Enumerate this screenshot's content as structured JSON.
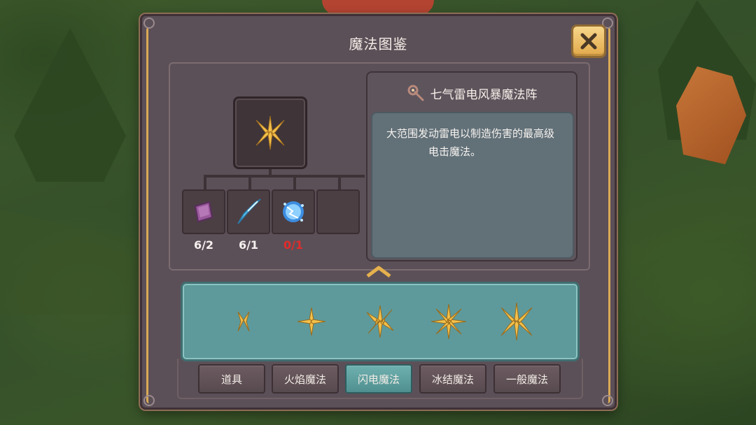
{
  "window": {
    "title": "魔法图鉴",
    "close_label": "✕"
  },
  "recipe": {
    "ingredients": [
      {
        "icon": "purple-crystal-icon",
        "count": "6/2",
        "sufficient": true
      },
      {
        "icon": "blue-shard-icon",
        "count": "6/1",
        "sufficient": true
      },
      {
        "icon": "lightning-orb-icon",
        "count": "0/1",
        "sufficient": false
      },
      {
        "icon": "empty-slot",
        "count": "",
        "sufficient": true
      }
    ]
  },
  "detail": {
    "name": "七气雷电风暴魔法阵",
    "description_line1": "大范围发动雷电以制造伤害的最高级",
    "description_line2": "电击魔法。"
  },
  "spells": [
    {
      "icon": "lightning-spell-1-icon"
    },
    {
      "icon": "lightning-spell-2-icon"
    },
    {
      "icon": "lightning-spell-3-icon"
    },
    {
      "icon": "lightning-spell-4-icon"
    },
    {
      "icon": "lightning-spell-5-icon"
    }
  ],
  "tabs": [
    {
      "label": "道具",
      "active": false
    },
    {
      "label": "火焰魔法",
      "active": false
    },
    {
      "label": "闪电魔法",
      "active": true
    },
    {
      "label": "冰结魔法",
      "active": false
    },
    {
      "label": "一般魔法",
      "active": false
    }
  ],
  "colors": {
    "accent_gold": "#d9a955",
    "shortage_red": "#e22b2b",
    "active_tab": "#5fa0a0",
    "spell_icon_gold": "#f3c14c"
  }
}
